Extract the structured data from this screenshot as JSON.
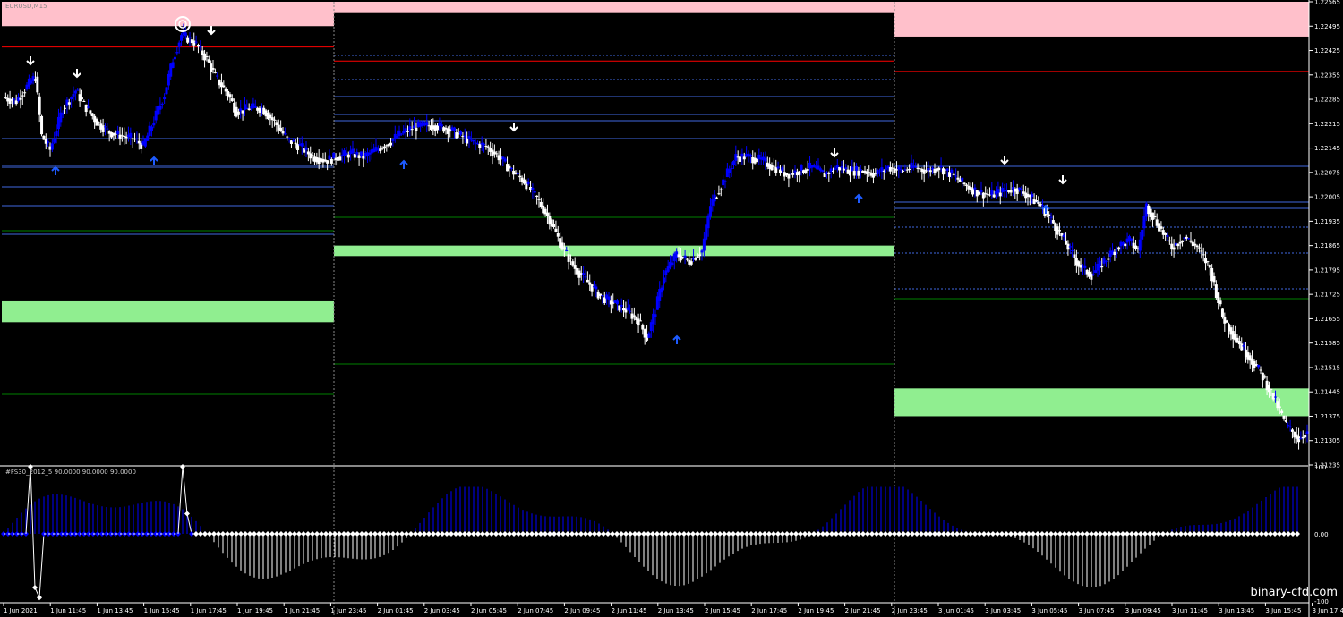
{
  "symbol_label": "EURUSD,M15",
  "indicator_label": "#FS30_2012_5 90.0000 90.0000 90.0000",
  "watermark": "binary-cfd.com",
  "colors": {
    "background": "#000000",
    "bull_candle": "#0000ff",
    "bear_candle": "#ffffff",
    "supply_zone": "#ffc0cb",
    "demand_zone": "#90ee90",
    "pivot": "#ff0000",
    "level_blue": "#4169e1",
    "level_green": "#008000",
    "signal_up": "#1e5bff",
    "signal_down": "#ffffff",
    "axis_text": "#ffffff",
    "separator": "#888888"
  },
  "chart_data": [
    {
      "type": "candlestick",
      "title": "EURUSD,M15",
      "y_ticks": [
        "1.22565",
        "1.22495",
        "1.22425",
        "1.22355",
        "1.22285",
        "1.22215",
        "1.22145",
        "1.22075",
        "1.22005",
        "1.21935",
        "1.21865",
        "1.21795",
        "1.21725",
        "1.21655",
        "1.21585",
        "1.21515",
        "1.21445",
        "1.21375",
        "1.21305",
        "1.21235"
      ],
      "ylim": [
        1.21235,
        1.22565
      ],
      "x_ticks": [
        "1 Jun 2021",
        "1 Jun 11:45",
        "1 Jun 13:45",
        "1 Jun 15:45",
        "1 Jun 17:45",
        "1 Jun 19:45",
        "1 Jun 21:45",
        "1 Jun 23:45",
        "2 Jun 01:45",
        "2 Jun 03:45",
        "2 Jun 05:45",
        "2 Jun 07:45",
        "2 Jun 09:45",
        "2 Jun 11:45",
        "2 Jun 13:45",
        "2 Jun 15:45",
        "2 Jun 17:45",
        "2 Jun 19:45",
        "2 Jun 21:45",
        "2 Jun 23:45",
        "3 Jun 01:45",
        "3 Jun 03:45",
        "3 Jun 05:45",
        "3 Jun 07:45",
        "3 Jun 09:45",
        "3 Jun 11:45",
        "3 Jun 13:45",
        "3 Jun 15:45",
        "3 Jun 17:45"
      ],
      "close_path": [
        [
          0,
          1.2229
        ],
        [
          6,
          1.2228
        ],
        [
          12,
          1.2233
        ],
        [
          15,
          1.2235
        ],
        [
          18,
          1.2218
        ],
        [
          22,
          1.2214
        ],
        [
          28,
          1.2226
        ],
        [
          34,
          1.2231
        ],
        [
          38,
          1.2227
        ],
        [
          44,
          1.2222
        ],
        [
          50,
          1.2219
        ],
        [
          56,
          1.2218
        ],
        [
          62,
          1.2217
        ],
        [
          66,
          1.2215
        ],
        [
          70,
          1.2221
        ],
        [
          76,
          1.223
        ],
        [
          80,
          1.224
        ],
        [
          84,
          1.2247
        ],
        [
          90,
          1.2245
        ],
        [
          96,
          1.224
        ],
        [
          100,
          1.2235
        ],
        [
          106,
          1.223
        ],
        [
          110,
          1.2225
        ],
        [
          116,
          1.2226
        ],
        [
          122,
          1.2226
        ],
        [
          128,
          1.2222
        ],
        [
          134,
          1.2217
        ],
        [
          140,
          1.2215
        ],
        [
          146,
          1.2212
        ],
        [
          152,
          1.2211
        ],
        [
          158,
          1.2212
        ],
        [
          164,
          1.2213
        ],
        [
          170,
          1.2212
        ],
        [
          176,
          1.2214
        ],
        [
          182,
          1.2216
        ],
        [
          186,
          1.2218
        ],
        [
          192,
          1.222
        ],
        [
          198,
          1.2221
        ],
        [
          204,
          1.2221
        ],
        [
          210,
          1.222
        ],
        [
          216,
          1.2218
        ],
        [
          222,
          1.2216
        ],
        [
          228,
          1.2215
        ],
        [
          234,
          1.2212
        ],
        [
          240,
          1.2208
        ],
        [
          246,
          1.2205
        ],
        [
          252,
          1.22
        ],
        [
          258,
          1.2194
        ],
        [
          264,
          1.2186
        ],
        [
          270,
          1.218
        ],
        [
          276,
          1.2176
        ],
        [
          282,
          1.2172
        ],
        [
          288,
          1.217
        ],
        [
          294,
          1.2168
        ],
        [
          300,
          1.2165
        ],
        [
          304,
          1.216
        ],
        [
          308,
          1.2168
        ],
        [
          312,
          1.2178
        ],
        [
          318,
          1.2184
        ],
        [
          324,
          1.2182
        ],
        [
          330,
          1.2185
        ],
        [
          334,
          1.2198
        ],
        [
          340,
          1.2205
        ],
        [
          346,
          1.2212
        ],
        [
          352,
          1.2212
        ],
        [
          358,
          1.2211
        ],
        [
          364,
          1.2209
        ],
        [
          370,
          1.2207
        ],
        [
          376,
          1.2208
        ],
        [
          382,
          1.2209
        ],
        [
          388,
          1.2207
        ],
        [
          394,
          1.2209
        ],
        [
          400,
          1.2208
        ],
        [
          406,
          1.2208
        ],
        [
          412,
          1.2207
        ],
        [
          418,
          1.2209
        ],
        [
          424,
          1.2208
        ],
        [
          430,
          1.2209
        ],
        [
          436,
          1.2208
        ],
        [
          442,
          1.2209
        ],
        [
          448,
          1.2207
        ],
        [
          454,
          1.2204
        ],
        [
          460,
          1.2202
        ],
        [
          466,
          1.2201
        ],
        [
          472,
          1.2202
        ],
        [
          478,
          1.2203
        ],
        [
          484,
          1.2201
        ],
        [
          490,
          1.2198
        ],
        [
          496,
          1.2193
        ],
        [
          502,
          1.2187
        ],
        [
          508,
          1.2181
        ],
        [
          514,
          1.2178
        ],
        [
          520,
          1.2182
        ],
        [
          526,
          1.2186
        ],
        [
          532,
          1.2188
        ],
        [
          536,
          1.2185
        ],
        [
          540,
          1.2198
        ],
        [
          546,
          1.2192
        ],
        [
          552,
          1.2186
        ],
        [
          558,
          1.2189
        ],
        [
          564,
          1.2186
        ],
        [
          570,
          1.218
        ],
        [
          576,
          1.2166
        ],
        [
          582,
          1.216
        ],
        [
          588,
          1.2155
        ],
        [
          594,
          1.215
        ],
        [
          600,
          1.2143
        ],
        [
          606,
          1.2135
        ],
        [
          612,
          1.2131
        ],
        [
          616,
          1.2133
        ]
      ],
      "zones": [
        {
          "type": "supply",
          "day": 1,
          "from": 1.22495,
          "to": 1.22565
        },
        {
          "type": "demand",
          "day": 1,
          "from": 1.21645,
          "to": 1.21705
        },
        {
          "type": "supply",
          "day": 2,
          "from": 1.22535,
          "to": 1.22565
        },
        {
          "type": "demand",
          "day": 2,
          "from": 1.21835,
          "to": 1.21865
        },
        {
          "type": "supply",
          "day": 3,
          "from": 1.22465,
          "to": 1.22565
        },
        {
          "type": "demand",
          "day": 3,
          "from": 1.21375,
          "to": 1.21455
        }
      ],
      "pivots": [
        {
          "day": 1,
          "value": 1.22435
        },
        {
          "day": 2,
          "value": 1.22395
        },
        {
          "day": 3,
          "value": 1.22365
        }
      ]
    },
    {
      "type": "histogram",
      "title": "#FS30_2012_5 90.0000 90.0000 90.0000",
      "y_ticks": [
        "100",
        "0.00",
        "-100"
      ],
      "ylim": [
        -100,
        100
      ]
    }
  ]
}
